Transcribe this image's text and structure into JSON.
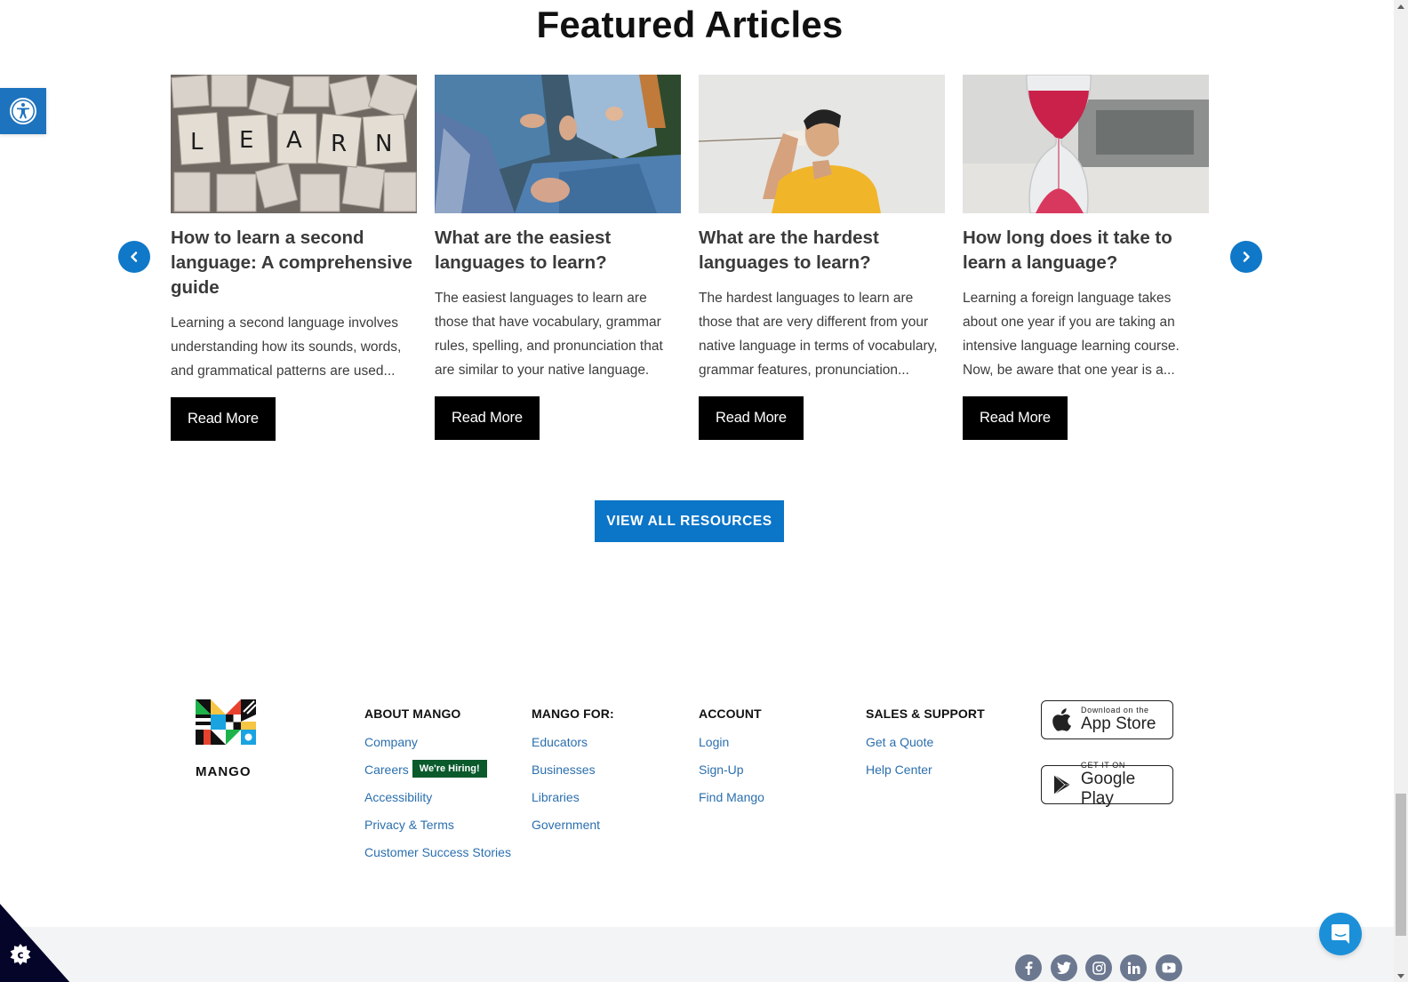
{
  "section": {
    "title": "Featured Articles"
  },
  "accessibility": {
    "icon": "accessibility-icon"
  },
  "carousel": {
    "prev_icon": "chevron-left-icon",
    "next_icon": "chevron-right-icon",
    "cards": [
      {
        "image": "scrabble-tiles-learn-image",
        "title": "How to learn a second language: A comprehensive guide",
        "excerpt": "Learning a second language involves understanding how its sounds, words, and grammatical patterns are used...",
        "button": "Read More"
      },
      {
        "image": "group-conversation-image",
        "title": "What are the easiest languages to learn?",
        "excerpt": "The easiest languages to learn are those that have vocabulary, grammar rules, spelling, and pronunciation that are similar to your native language.",
        "button": "Read More"
      },
      {
        "image": "man-tin-can-phone-image",
        "title": "What are the hardest languages to learn?",
        "excerpt": "The hardest languages to learn are those that are very different from your native language in terms of vocabulary, grammar features, pronunciation...",
        "button": "Read More"
      },
      {
        "image": "hourglass-image",
        "title": "How long does it take to learn a language?",
        "excerpt": "Learning a foreign language takes about one year if you are taking an intensive language learning course. Now, be aware that one year is a...",
        "button": "Read More"
      }
    ]
  },
  "view_all": {
    "label": "VIEW ALL RESOURCES"
  },
  "footer": {
    "logo_text": "MANGO",
    "columns": [
      {
        "heading": "ABOUT MANGO",
        "links": [
          "Company",
          "Careers",
          "Accessibility",
          "Privacy & Terms",
          "Customer Success Stories"
        ]
      },
      {
        "heading": "MANGO FOR:",
        "links": [
          "Educators",
          "Businesses",
          "Libraries",
          "Government"
        ]
      },
      {
        "heading": "ACCOUNT",
        "links": [
          "Login",
          "Sign-Up",
          "Find Mango"
        ]
      },
      {
        "heading": "SALES & SUPPORT",
        "links": [
          "Get a Quote",
          "Help Center"
        ]
      }
    ],
    "hiring_badge": "We're Hiring!",
    "app_store": {
      "small": "Download on the",
      "big": "App Store"
    },
    "google_play": {
      "small": "GET IT ON",
      "big": "Google Play"
    },
    "social": [
      "facebook-icon",
      "twitter-icon",
      "instagram-icon",
      "linkedin-icon",
      "youtube-icon"
    ]
  },
  "colors": {
    "accent_blue": "#0b75c8",
    "link_blue": "#2b6fae",
    "hiring_green": "#0a5a2c",
    "chat_blue": "#1b90d8",
    "cookie_navy": "#05052a"
  }
}
